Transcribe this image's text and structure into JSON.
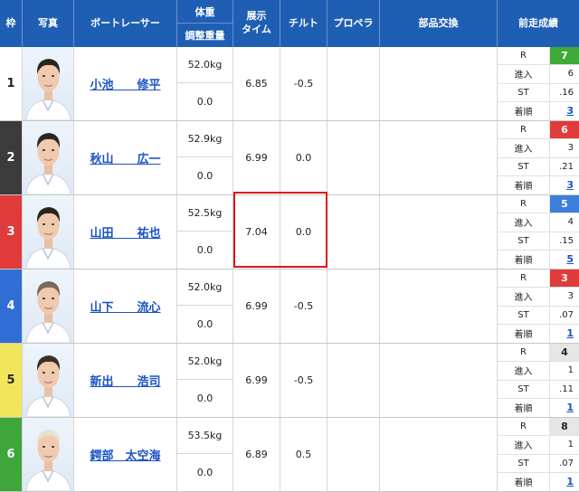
{
  "headers": {
    "waku": "枠",
    "photo": "写真",
    "racer": "ボートレーサー",
    "weight_top": "体重",
    "weight_bottom": "調整重量",
    "exhibit": "展示\nタイム",
    "tilt": "チルト",
    "propeller": "プロペラ",
    "parts": "部品交換",
    "previous": "前走成績"
  },
  "prev_labels": {
    "r": "R",
    "entry": "進入",
    "st": "ST",
    "finish": "着順"
  },
  "racers": [
    {
      "waku": "1",
      "waku_color": "#ffffff",
      "waku_text": "#222222",
      "name": "小池　　修平",
      "weight": "52.0kg",
      "adjust": "0.0",
      "exhibit": "6.85",
      "tilt": "-0.5",
      "prev_r": "7",
      "prev_r_bg": "#3fa93a",
      "prev_r_fg": "#ffffff",
      "prev_entry": "6",
      "prev_st": ".16",
      "prev_finish": "3"
    },
    {
      "waku": "2",
      "waku_color": "#3b3b3b",
      "waku_text": "#ffffff",
      "name": "秋山　　広一",
      "weight": "52.9kg",
      "adjust": "0.0",
      "exhibit": "6.99",
      "tilt": "0.0",
      "prev_r": "6",
      "prev_r_bg": "#e03b3b",
      "prev_r_fg": "#ffffff",
      "prev_entry": "3",
      "prev_st": ".21",
      "prev_finish": "3"
    },
    {
      "waku": "3",
      "waku_color": "#e03a3a",
      "waku_text": "#ffffff",
      "name": "山田　　祐也",
      "weight": "52.5kg",
      "adjust": "0.0",
      "exhibit": "7.04",
      "tilt": "0.0",
      "prev_r": "5",
      "prev_r_bg": "#3b7fd9",
      "prev_r_fg": "#ffffff",
      "prev_entry": "4",
      "prev_st": ".15",
      "prev_finish": "5"
    },
    {
      "waku": "4",
      "waku_color": "#2f6fd3",
      "waku_text": "#ffffff",
      "name": "山下　　流心",
      "weight": "52.0kg",
      "adjust": "0.0",
      "exhibit": "6.99",
      "tilt": "-0.5",
      "prev_r": "3",
      "prev_r_bg": "#e03b3b",
      "prev_r_fg": "#ffffff",
      "prev_entry": "3",
      "prev_st": ".07",
      "prev_finish": "1"
    },
    {
      "waku": "5",
      "waku_color": "#f1e65a",
      "waku_text": "#222222",
      "name": "新出　　浩司",
      "weight": "52.0kg",
      "adjust": "0.0",
      "exhibit": "6.99",
      "tilt": "-0.5",
      "prev_r": "4",
      "prev_r_bg": "#e6e6e6",
      "prev_r_fg": "#222222",
      "prev_entry": "1",
      "prev_st": ".11",
      "prev_finish": "1"
    },
    {
      "waku": "6",
      "waku_color": "#3ea63a",
      "waku_text": "#ffffff",
      "name": "鍔部　太空海",
      "weight": "53.5kg",
      "adjust": "0.0",
      "exhibit": "6.89",
      "tilt": "0.5",
      "prev_r": "8",
      "prev_r_bg": "#e6e6e6",
      "prev_r_fg": "#222222",
      "prev_entry": "1",
      "prev_st": ".07",
      "prev_finish": "1"
    }
  ]
}
